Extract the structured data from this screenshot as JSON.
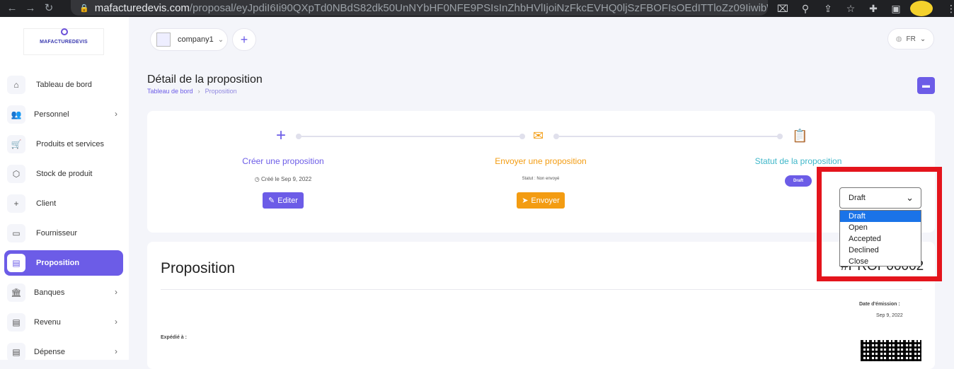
{
  "browser": {
    "url_host": "mafacturedevis.com",
    "url_path": "/proposal/eyJpdiI6Ii90QXpTd0NBdS82dk50UnNYbHF0NFE9PSIsInZhbHVlIjoiNzFkcEVHQ0ljSzFBOFIsOEdITTloZz09IiwibWFjIjoiZDgyM..."
  },
  "sidebar": {
    "logo_text": "MAFACTUREDEVIS",
    "items": [
      {
        "label": "Tableau de bord",
        "icon": "home-icon",
        "chevron": false
      },
      {
        "label": "Personnel",
        "icon": "users-icon",
        "chevron": true
      },
      {
        "label": "Produits et services",
        "icon": "cart-icon",
        "chevron": false
      },
      {
        "label": "Stock de produit",
        "icon": "box-icon",
        "chevron": false
      },
      {
        "label": "Client",
        "icon": "user-plus-icon",
        "chevron": false
      },
      {
        "label": "Fournisseur",
        "icon": "note-icon",
        "chevron": false
      },
      {
        "label": "Proposition",
        "icon": "file-icon",
        "chevron": false,
        "active": true
      },
      {
        "label": "Banques",
        "icon": "bank-icon",
        "chevron": true
      },
      {
        "label": "Revenu",
        "icon": "file-text-icon",
        "chevron": true
      },
      {
        "label": "Dépense",
        "icon": "receipt-icon",
        "chevron": true
      }
    ]
  },
  "topbar": {
    "company": "company1",
    "language": "FR"
  },
  "page": {
    "title": "Détail de la proposition",
    "breadcrumb": [
      "Tableau de bord",
      "Proposition"
    ]
  },
  "steps": {
    "create_title": "Créer une proposition",
    "create_sub": "Créé le Sep 9, 2022",
    "edit_label": "Editer",
    "send_title": "Envoyer une proposition",
    "send_sub": "Statut : Non envoyé",
    "send_label": "Envoyer",
    "status_title": "Statut de la proposition",
    "status_pill": "Draft",
    "colors": {
      "create": "#6c5ce7",
      "send": "#f39c12",
      "status": "#3fb7c9"
    }
  },
  "status_select": {
    "value": "Draft",
    "options": [
      "Draft",
      "Open",
      "Accepted",
      "Declined",
      "Close"
    ],
    "selected_index": 0
  },
  "proposal": {
    "heading": "Proposition",
    "number": "#PROP00002",
    "issue_label": "Date d'émission :",
    "issue_date": "Sep 9, 2022",
    "shipped_label": "Expédié à :"
  }
}
